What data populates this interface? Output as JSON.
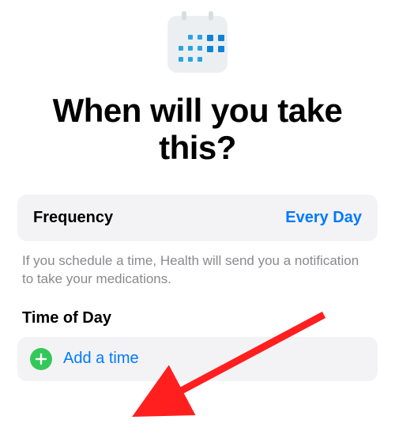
{
  "title": "When will you take this?",
  "frequency": {
    "label": "Frequency",
    "value": "Every Day"
  },
  "hint": "If you schedule a time, Health will send you a notification to take your medications.",
  "time_of_day": {
    "section_title": "Time of Day",
    "add_label": "Add a time"
  },
  "colors": {
    "accent": "#007aff",
    "add_green": "#34c759",
    "hint_text": "#8a8a8e",
    "row_bg": "#f3f3f5",
    "arrow": "#ff1f1f"
  }
}
